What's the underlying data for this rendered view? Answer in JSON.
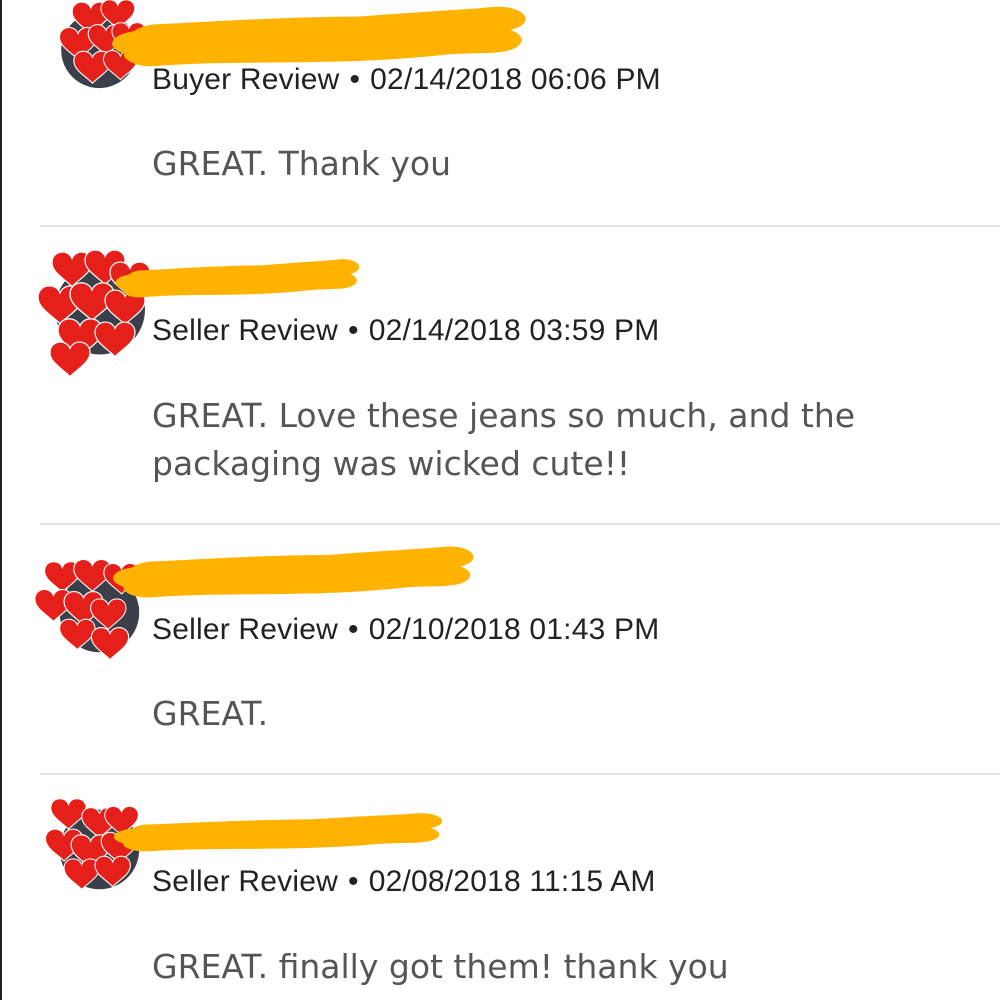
{
  "accent": "#FFB300",
  "heart_color": "#E5201A",
  "reviews": [
    {
      "type": "Buyer Review",
      "datetime": "02/14/2018 06:06 PM",
      "comment": "GREAT. Thank you"
    },
    {
      "type": "Seller Review",
      "datetime": "02/14/2018 03:59 PM",
      "comment": "GREAT. Love these jeans so much, and the packaging was wicked cute!!"
    },
    {
      "type": "Seller Review",
      "datetime": "02/10/2018 01:43 PM",
      "comment": "GREAT."
    },
    {
      "type": "Seller Review",
      "datetime": "02/08/2018 11:15 AM",
      "comment": "GREAT. finally got them! thank you"
    }
  ],
  "separator": "•",
  "avatar_icon": "hearts-sticker-icon",
  "redaction_icon": "marker-scribble-icon"
}
